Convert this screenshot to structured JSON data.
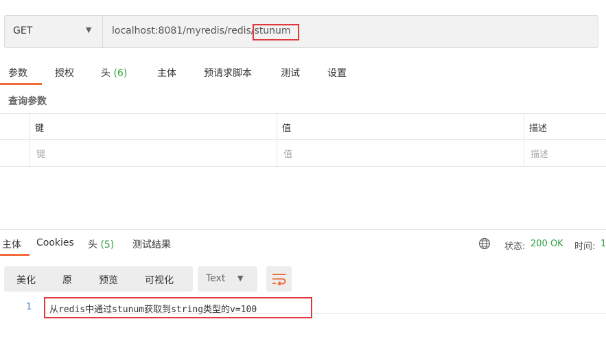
{
  "request": {
    "method": "GET",
    "url": "localhost:8081/myredis/redis/stunum"
  },
  "request_tabs": [
    {
      "label": "参数",
      "count": ""
    },
    {
      "label": "授权",
      "count": ""
    },
    {
      "label": "头",
      "count": "(6)"
    },
    {
      "label": "主体",
      "count": ""
    },
    {
      "label": "预请求脚本",
      "count": ""
    },
    {
      "label": "测试",
      "count": ""
    },
    {
      "label": "设置",
      "count": ""
    }
  ],
  "query_params": {
    "title": "查询参数",
    "columns": [
      "键",
      "值",
      "描述"
    ],
    "placeholders": [
      "键",
      "值",
      "描述"
    ]
  },
  "response_tabs": [
    {
      "label": "主体",
      "count": ""
    },
    {
      "label": "Cookies",
      "count": ""
    },
    {
      "label": "头",
      "count": "(5)"
    },
    {
      "label": "测试结果",
      "count": ""
    }
  ],
  "response_status": {
    "status_label": "状态:",
    "status_value": "200 OK",
    "time_label": "时间:",
    "time_value": "1"
  },
  "view_modes": [
    "美化",
    "原",
    "预览",
    "可视化"
  ],
  "language": "Text",
  "response_body": {
    "line_number": "1",
    "content": "从redis中通过stunum获取到string类型的v=100"
  },
  "accent_color": "#f26b3a",
  "highlight_color": "#e0373b",
  "icons": [
    "chevron-down-icon",
    "globe-icon",
    "wrap-lines-icon"
  ]
}
